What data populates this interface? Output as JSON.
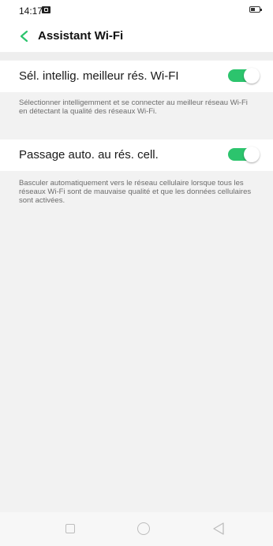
{
  "status_bar": {
    "time": "14:17"
  },
  "header": {
    "title": "Assistant Wi-Fi",
    "back_icon": "chevron-left-icon",
    "accent_color": "#2cc46d"
  },
  "settings": [
    {
      "label": "Sél. intellig. meilleur rés. Wi-FI",
      "enabled": true,
      "description": "Sélectionner intelligemment et se connecter au meilleur réseau Wi-Fi en détectant la qualité des réseaux Wi-Fi."
    },
    {
      "label": "Passage auto. au rés. cell.",
      "enabled": true,
      "description": "Basculer automatiquement vers le réseau cellulaire lorsque tous les réseaux Wi-Fi sont de mauvaise qualité et que les données cellulaires sont activées."
    }
  ],
  "nav_bar": {
    "icons": [
      "recent-apps-icon",
      "home-icon",
      "back-icon"
    ]
  }
}
